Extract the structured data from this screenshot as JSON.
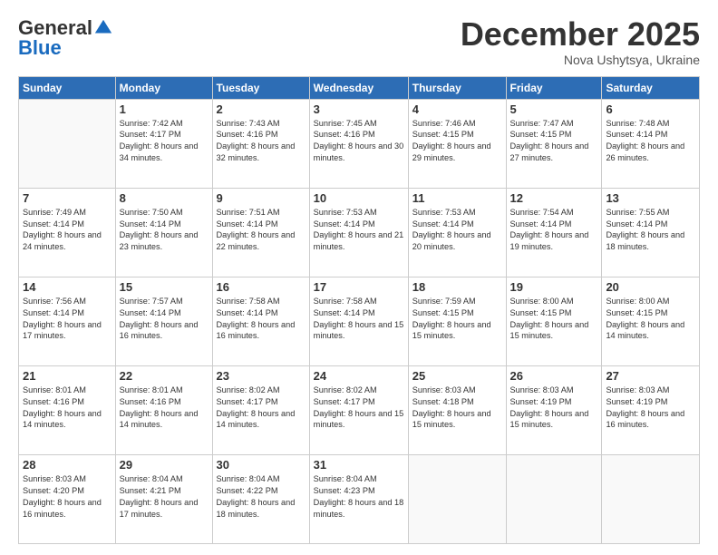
{
  "logo": {
    "general": "General",
    "blue": "Blue"
  },
  "header": {
    "month": "December 2025",
    "location": "Nova Ushytsya, Ukraine"
  },
  "days_of_week": [
    "Sunday",
    "Monday",
    "Tuesday",
    "Wednesday",
    "Thursday",
    "Friday",
    "Saturday"
  ],
  "weeks": [
    [
      {
        "day": "",
        "sunrise": "",
        "sunset": "",
        "daylight": ""
      },
      {
        "day": "1",
        "sunrise": "Sunrise: 7:42 AM",
        "sunset": "Sunset: 4:17 PM",
        "daylight": "Daylight: 8 hours and 34 minutes."
      },
      {
        "day": "2",
        "sunrise": "Sunrise: 7:43 AM",
        "sunset": "Sunset: 4:16 PM",
        "daylight": "Daylight: 8 hours and 32 minutes."
      },
      {
        "day": "3",
        "sunrise": "Sunrise: 7:45 AM",
        "sunset": "Sunset: 4:16 PM",
        "daylight": "Daylight: 8 hours and 30 minutes."
      },
      {
        "day": "4",
        "sunrise": "Sunrise: 7:46 AM",
        "sunset": "Sunset: 4:15 PM",
        "daylight": "Daylight: 8 hours and 29 minutes."
      },
      {
        "day": "5",
        "sunrise": "Sunrise: 7:47 AM",
        "sunset": "Sunset: 4:15 PM",
        "daylight": "Daylight: 8 hours and 27 minutes."
      },
      {
        "day": "6",
        "sunrise": "Sunrise: 7:48 AM",
        "sunset": "Sunset: 4:14 PM",
        "daylight": "Daylight: 8 hours and 26 minutes."
      }
    ],
    [
      {
        "day": "7",
        "sunrise": "Sunrise: 7:49 AM",
        "sunset": "Sunset: 4:14 PM",
        "daylight": "Daylight: 8 hours and 24 minutes."
      },
      {
        "day": "8",
        "sunrise": "Sunrise: 7:50 AM",
        "sunset": "Sunset: 4:14 PM",
        "daylight": "Daylight: 8 hours and 23 minutes."
      },
      {
        "day": "9",
        "sunrise": "Sunrise: 7:51 AM",
        "sunset": "Sunset: 4:14 PM",
        "daylight": "Daylight: 8 hours and 22 minutes."
      },
      {
        "day": "10",
        "sunrise": "Sunrise: 7:53 AM",
        "sunset": "Sunset: 4:14 PM",
        "daylight": "Daylight: 8 hours and 21 minutes."
      },
      {
        "day": "11",
        "sunrise": "Sunrise: 7:53 AM",
        "sunset": "Sunset: 4:14 PM",
        "daylight": "Daylight: 8 hours and 20 minutes."
      },
      {
        "day": "12",
        "sunrise": "Sunrise: 7:54 AM",
        "sunset": "Sunset: 4:14 PM",
        "daylight": "Daylight: 8 hours and 19 minutes."
      },
      {
        "day": "13",
        "sunrise": "Sunrise: 7:55 AM",
        "sunset": "Sunset: 4:14 PM",
        "daylight": "Daylight: 8 hours and 18 minutes."
      }
    ],
    [
      {
        "day": "14",
        "sunrise": "Sunrise: 7:56 AM",
        "sunset": "Sunset: 4:14 PM",
        "daylight": "Daylight: 8 hours and 17 minutes."
      },
      {
        "day": "15",
        "sunrise": "Sunrise: 7:57 AM",
        "sunset": "Sunset: 4:14 PM",
        "daylight": "Daylight: 8 hours and 16 minutes."
      },
      {
        "day": "16",
        "sunrise": "Sunrise: 7:58 AM",
        "sunset": "Sunset: 4:14 PM",
        "daylight": "Daylight: 8 hours and 16 minutes."
      },
      {
        "day": "17",
        "sunrise": "Sunrise: 7:58 AM",
        "sunset": "Sunset: 4:14 PM",
        "daylight": "Daylight: 8 hours and 15 minutes."
      },
      {
        "day": "18",
        "sunrise": "Sunrise: 7:59 AM",
        "sunset": "Sunset: 4:15 PM",
        "daylight": "Daylight: 8 hours and 15 minutes."
      },
      {
        "day": "19",
        "sunrise": "Sunrise: 8:00 AM",
        "sunset": "Sunset: 4:15 PM",
        "daylight": "Daylight: 8 hours and 15 minutes."
      },
      {
        "day": "20",
        "sunrise": "Sunrise: 8:00 AM",
        "sunset": "Sunset: 4:15 PM",
        "daylight": "Daylight: 8 hours and 14 minutes."
      }
    ],
    [
      {
        "day": "21",
        "sunrise": "Sunrise: 8:01 AM",
        "sunset": "Sunset: 4:16 PM",
        "daylight": "Daylight: 8 hours and 14 minutes."
      },
      {
        "day": "22",
        "sunrise": "Sunrise: 8:01 AM",
        "sunset": "Sunset: 4:16 PM",
        "daylight": "Daylight: 8 hours and 14 minutes."
      },
      {
        "day": "23",
        "sunrise": "Sunrise: 8:02 AM",
        "sunset": "Sunset: 4:17 PM",
        "daylight": "Daylight: 8 hours and 14 minutes."
      },
      {
        "day": "24",
        "sunrise": "Sunrise: 8:02 AM",
        "sunset": "Sunset: 4:17 PM",
        "daylight": "Daylight: 8 hours and 15 minutes."
      },
      {
        "day": "25",
        "sunrise": "Sunrise: 8:03 AM",
        "sunset": "Sunset: 4:18 PM",
        "daylight": "Daylight: 8 hours and 15 minutes."
      },
      {
        "day": "26",
        "sunrise": "Sunrise: 8:03 AM",
        "sunset": "Sunset: 4:19 PM",
        "daylight": "Daylight: 8 hours and 15 minutes."
      },
      {
        "day": "27",
        "sunrise": "Sunrise: 8:03 AM",
        "sunset": "Sunset: 4:19 PM",
        "daylight": "Daylight: 8 hours and 16 minutes."
      }
    ],
    [
      {
        "day": "28",
        "sunrise": "Sunrise: 8:03 AM",
        "sunset": "Sunset: 4:20 PM",
        "daylight": "Daylight: 8 hours and 16 minutes."
      },
      {
        "day": "29",
        "sunrise": "Sunrise: 8:04 AM",
        "sunset": "Sunset: 4:21 PM",
        "daylight": "Daylight: 8 hours and 17 minutes."
      },
      {
        "day": "30",
        "sunrise": "Sunrise: 8:04 AM",
        "sunset": "Sunset: 4:22 PM",
        "daylight": "Daylight: 8 hours and 18 minutes."
      },
      {
        "day": "31",
        "sunrise": "Sunrise: 8:04 AM",
        "sunset": "Sunset: 4:23 PM",
        "daylight": "Daylight: 8 hours and 18 minutes."
      },
      {
        "day": "",
        "sunrise": "",
        "sunset": "",
        "daylight": ""
      },
      {
        "day": "",
        "sunrise": "",
        "sunset": "",
        "daylight": ""
      },
      {
        "day": "",
        "sunrise": "",
        "sunset": "",
        "daylight": ""
      }
    ]
  ]
}
